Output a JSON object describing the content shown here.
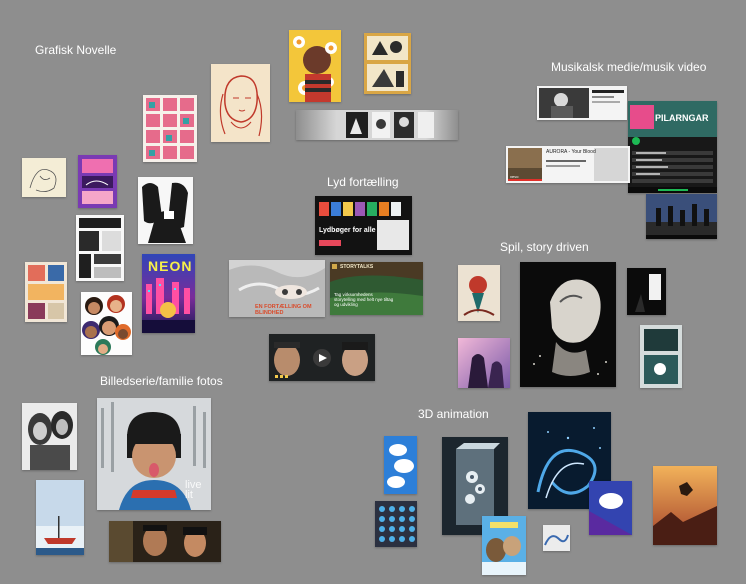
{
  "sections": {
    "graphic_novel": "Grafisk Novelle",
    "music_media": "Musikalsk medie/musik video",
    "audio_story": "Lyd fortælling",
    "games_story": "Spil, story driven",
    "photo_series": "Billedserie/familie fotos",
    "animation_3d": "3D animation"
  },
  "thumbnails": {
    "spotify_title": "PILARNGAR",
    "youtube_title": "AURORA - Your Blood",
    "vevo_label": "vevo",
    "audiobook_title": "Lydbøger for alle",
    "story_mag_title": "STORYTALKS",
    "story_mag_text": "Tag virksomhedens storytelling med helt nye tiltag og udvikling",
    "documentary_text": "EN FORTÆLLING OM BLINDHED",
    "neon_title": "NEON",
    "glimpse_text": "live lit"
  },
  "colors": {
    "canvas": "#8e8e8e",
    "label": "#ffffff",
    "spotify_green": "#1db954"
  }
}
